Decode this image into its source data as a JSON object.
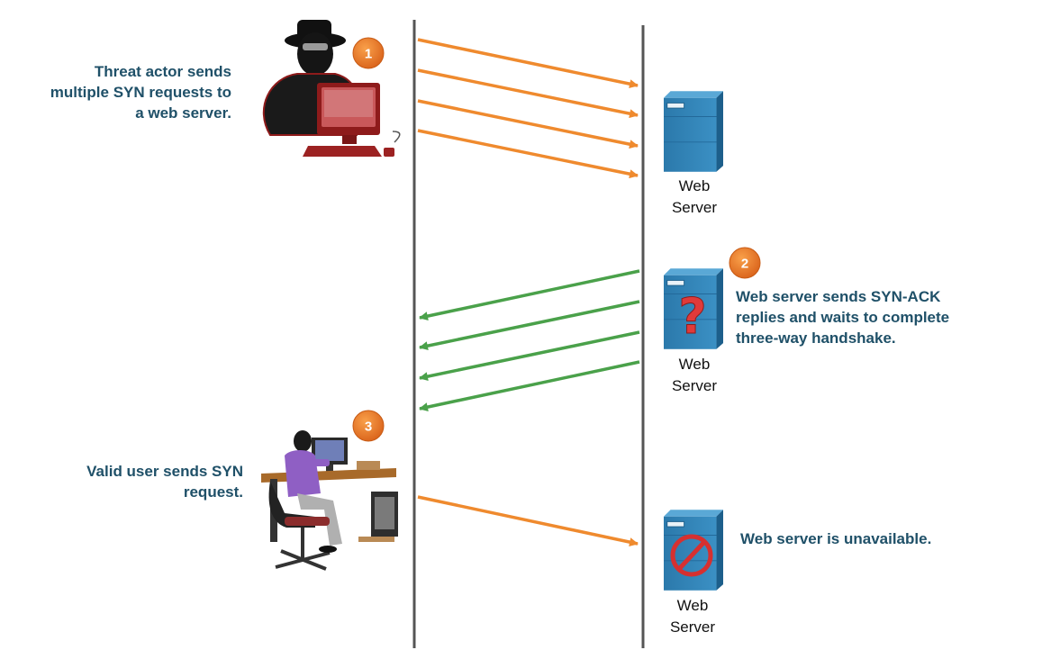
{
  "colors": {
    "caption_text": "#1f5068",
    "timeline": "#555555",
    "syn_arrow": "#ef8a2e",
    "synack_arrow": "#4aa14a",
    "badge": "#e8731f",
    "server_body": "#2f83b6",
    "threat_red": "#8e1b1b"
  },
  "icons": {
    "threat_actor": "hooded-hacker-with-computer-icon",
    "valid_user": "person-at-desk-computer-icon",
    "server": "tower-server-icon",
    "question": "question-mark-icon",
    "blocked": "prohibited-sign-icon"
  },
  "steps": [
    {
      "badge": "1",
      "caption": "Threat actor sends\nmultiple SYN requests to\na web server."
    },
    {
      "badge": "2",
      "caption": "Web server sends SYN-ACK\nreplies and waits to complete\nthree-way handshake."
    },
    {
      "badge": "3",
      "caption": "Valid user sends SYN\nrequest."
    }
  ],
  "server_label": "Web\nServer",
  "unavailable_caption": "Web server is unavailable."
}
